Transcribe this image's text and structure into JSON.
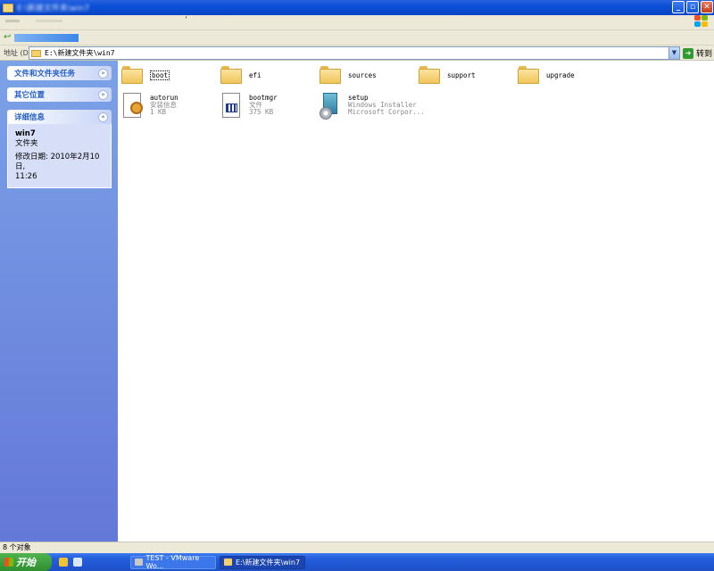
{
  "window": {
    "title_blur": "E:\\新建文件夹\\win7",
    "menubar_mark": "’",
    "controls": {
      "minimize": "_",
      "maximize": "▫",
      "close": "✕"
    }
  },
  "address_bar": {
    "label": "地址 (D)",
    "path": "E:\\新建文件夹\\win7",
    "go_label": "转到"
  },
  "task_pane": {
    "panels": [
      {
        "title": "文件和文件夹任务",
        "state": "collapsed"
      },
      {
        "title": "其它位置",
        "state": "collapsed"
      },
      {
        "title": "详细信息",
        "state": "expanded",
        "name": "win7",
        "type": "文件夹",
        "modified_label": "修改日期: 2010年2月10日,",
        "modified_time": "11:26"
      }
    ]
  },
  "files": {
    "folders": [
      "boot",
      "efi",
      "sources",
      "support",
      "upgrade"
    ],
    "items": [
      {
        "name": "autorun",
        "type": "安装信息",
        "size": "1 KB",
        "icon": "setup-info-icon"
      },
      {
        "name": "bootmgr",
        "type": "文件",
        "size": "375 KB",
        "icon": "system-file-icon"
      },
      {
        "name": "setup",
        "type": "Windows Installer",
        "size": "Microsoft Corpor...",
        "icon": "installer-icon"
      }
    ]
  },
  "status": {
    "count": "8 个对象"
  },
  "taskbar": {
    "start_label": "开始",
    "tasks": [
      {
        "label": "TEST - VMware Wo..."
      },
      {
        "label": "E:\\新建文件夹\\win7"
      }
    ]
  },
  "colors": {
    "titlebar": "#0b4fd6",
    "task_pane": "#6d8fdf",
    "panel_title": "#215dc6",
    "folder": "#f0c55a",
    "start_button": "#2f8f2f"
  }
}
